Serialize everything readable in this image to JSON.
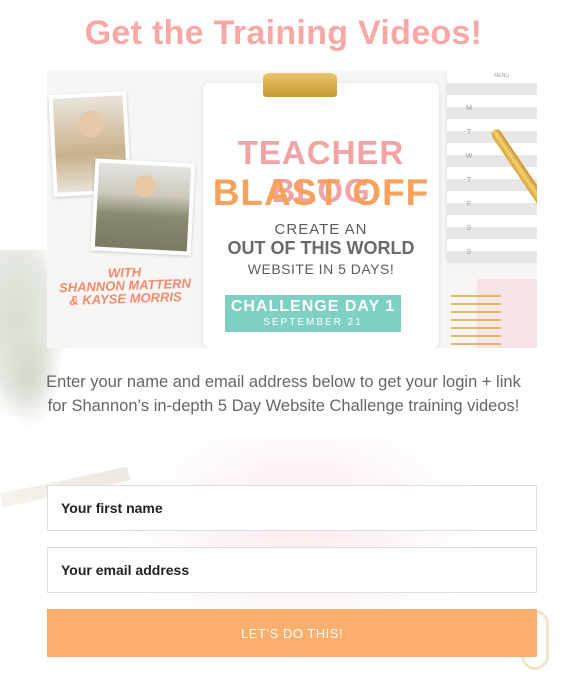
{
  "heading": "Get the Training Videos!",
  "hero": {
    "title_line1": "TEACHER BLOG",
    "title_line2": "BLAST OFF",
    "subtitle_line1": "CREATE AN",
    "subtitle_line2": "OUT OF THIS WORLD",
    "subtitle_line3": "WEBSITE IN 5 DAYS!",
    "badge_line1": "CHALLENGE DAY 1",
    "badge_line2": "SEPTEMBER 21",
    "hosts_line1": "WITH",
    "hosts_line2": "SHANNON MATTERN",
    "hosts_line3": "& KAYSE MORRIS",
    "planner_menu": "MENU",
    "planner_days": [
      "M",
      "T",
      "W",
      "T",
      "F",
      "S",
      "S"
    ]
  },
  "description": "Enter your name and email address below to get your login + link for Shannon’s in-depth 5 Day Website Challenge training videos!",
  "form": {
    "first_name_placeholder": "Your first name",
    "first_name_value": "",
    "email_placeholder": "Your email address",
    "email_value": "",
    "submit_label": "LET’S DO THIS!"
  },
  "colors": {
    "heading": "#f9a8a6",
    "button": "#fcae6d",
    "badge": "#7fd0c4",
    "blast_off": "#f7a25c"
  }
}
